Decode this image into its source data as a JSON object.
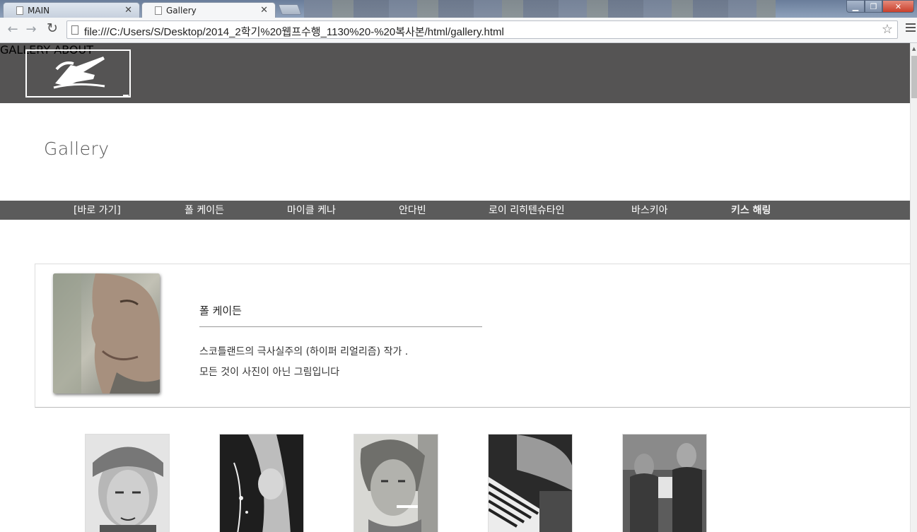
{
  "browser": {
    "tabs": [
      {
        "label": "MAIN",
        "active": false
      },
      {
        "label": "Gallery",
        "active": true
      }
    ],
    "url": "file:///C:/Users/S/Desktop/2014_2학기%20웹프수행_1130%20-%20복사본/html/gallery.html"
  },
  "header": {
    "nav": [
      "GALLERY",
      "ABOUT"
    ]
  },
  "page": {
    "title": "Gallery"
  },
  "artist_nav": [
    {
      "label": "[바로 가기]",
      "active": false
    },
    {
      "label": "폴 케이든",
      "active": false
    },
    {
      "label": "마이클 케나",
      "active": false
    },
    {
      "label": "안다빈",
      "active": false
    },
    {
      "label": "로이 리히텐슈타인",
      "active": false
    },
    {
      "label": "바스키아",
      "active": false
    },
    {
      "label": "키스 해링",
      "active": true
    }
  ],
  "artist": {
    "name": "폴 케이든",
    "description_lines": [
      "스코틀랜드의 극사실주의 (하이퍼 리얼리즘) 작가 .",
      "모든 것이 사진이 아닌 그림입니다"
    ]
  },
  "gallery_items": [
    {
      "subject": "elderly-woman-portrait"
    },
    {
      "subject": "figure-with-water"
    },
    {
      "subject": "man-smoking"
    },
    {
      "subject": "man-striped-sleeve"
    },
    {
      "subject": "two-men-street"
    }
  ]
}
